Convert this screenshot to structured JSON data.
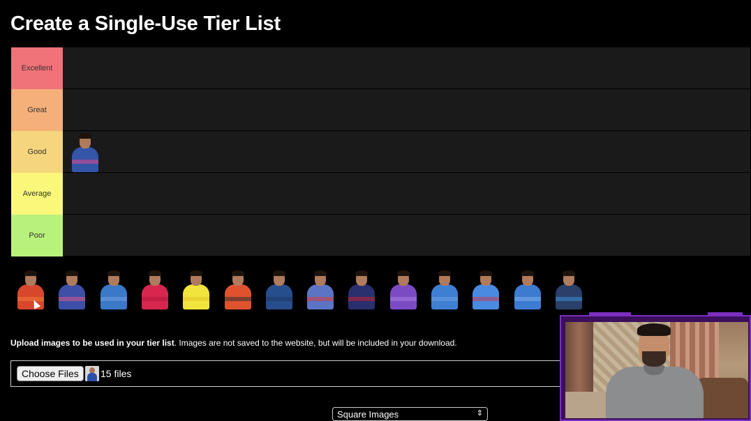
{
  "page": {
    "title": "Create a Single-Use Tier List"
  },
  "tiers": [
    {
      "label": "Excellent",
      "color": "#f0737a"
    },
    {
      "label": "Great",
      "color": "#f5b07a"
    },
    {
      "label": "Good",
      "color": "#f6d67c"
    },
    {
      "label": "Average",
      "color": "#fbf77b"
    },
    {
      "label": "Poor",
      "color": "#b9f27a"
    }
  ],
  "placed": [
    {
      "tier": "Good",
      "name": "player-blue-pink-kit",
      "jersey": "#3455a8",
      "accent": "#e0488e"
    }
  ],
  "pool": [
    {
      "name": "player-1",
      "jersey": "#d8472c",
      "accent": "#f07a3a"
    },
    {
      "name": "player-2",
      "jersey": "#3d4fa6",
      "accent": "#e05a8a"
    },
    {
      "name": "player-3",
      "jersey": "#3b78c6",
      "accent": "#6fa3dd"
    },
    {
      "name": "player-4",
      "jersey": "#d7274f",
      "accent": "#b5183e"
    },
    {
      "name": "player-5",
      "jersey": "#f1e43c",
      "accent": "#e2c42a"
    },
    {
      "name": "player-6",
      "jersey": "#e0522e",
      "accent": "#2f2f2f"
    },
    {
      "name": "player-7",
      "jersey": "#264e8c",
      "accent": "#1c3763"
    },
    {
      "name": "player-8",
      "jersey": "#5b74c4",
      "accent": "#d63c3c"
    },
    {
      "name": "player-9",
      "jersey": "#2a2f6d",
      "accent": "#c4232f"
    },
    {
      "name": "player-10",
      "jersey": "#7b4bc4",
      "accent": "#a77ee0"
    },
    {
      "name": "player-11",
      "jersey": "#3f7fd2",
      "accent": "#6aa2e3"
    },
    {
      "name": "player-12",
      "jersey": "#4a8ae0",
      "accent": "#c43c5a"
    },
    {
      "name": "player-13",
      "jersey": "#3d7bd0",
      "accent": "#7ab0ea"
    },
    {
      "name": "player-14",
      "jersey": "#2a3f6a",
      "accent": "#3a8fd0"
    }
  ],
  "upload": {
    "note_bold": "Upload images to be used in your tier list",
    "note_rest": ". Images are not saved to the website, but will be included in your download.",
    "choose_label": "Choose Files",
    "file_count": "15 files"
  },
  "image_shape": {
    "selected": "Square Images",
    "arrow": "⇕"
  }
}
